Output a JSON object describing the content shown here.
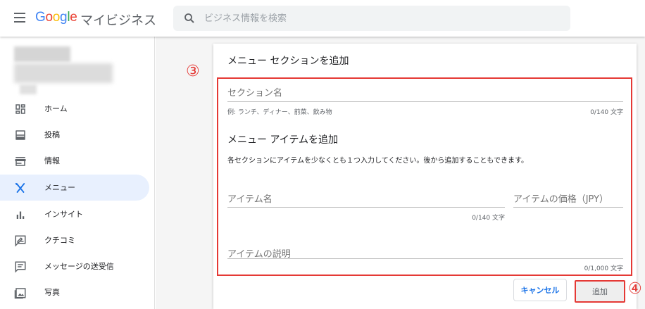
{
  "header": {
    "logo_letters": [
      "G",
      "o",
      "o",
      "g",
      "l",
      "e"
    ],
    "app_name": "マイビジネス",
    "search_placeholder": "ビジネス情報を検索"
  },
  "sidebar": {
    "items": [
      {
        "label": "ホーム",
        "icon": "dashboard-icon",
        "active": false
      },
      {
        "label": "投稿",
        "icon": "post-icon",
        "active": false
      },
      {
        "label": "情報",
        "icon": "storefront-icon",
        "active": false
      },
      {
        "label": "メニュー",
        "icon": "restaurant-icon",
        "active": true
      },
      {
        "label": "インサイト",
        "icon": "bar-chart-icon",
        "active": false
      },
      {
        "label": "クチコミ",
        "icon": "rate-review-icon",
        "active": false
      },
      {
        "label": "メッセージの送受信",
        "icon": "message-icon",
        "active": false
      },
      {
        "label": "写真",
        "icon": "photo-icon",
        "active": false
      }
    ]
  },
  "dialog": {
    "title": "メニュー セクションを追加",
    "section_name": {
      "label": "セクション名",
      "helper": "例: ランチ、ディナー、前菜、飲み物",
      "counter": "0/140 文字"
    },
    "item_heading": "メニュー アイテムを追加",
    "item_description": "各セクションにアイテムを少なくとも１つ入力してください。後から追加することもできます。",
    "item_name": {
      "label": "アイテム名",
      "counter": "0/140 文字"
    },
    "item_price": {
      "label": "アイテムの価格（JPY）"
    },
    "item_desc": {
      "label": "アイテムの説明",
      "counter": "0/1,000 文字"
    },
    "cancel_label": "キャンセル",
    "add_label": "追加"
  },
  "annotations": {
    "marker_3": "③",
    "marker_4": "④"
  },
  "colors": {
    "accent": "#1a73e8",
    "highlight_red": "#e53935",
    "active_nav_bg": "#e8f0fe"
  }
}
